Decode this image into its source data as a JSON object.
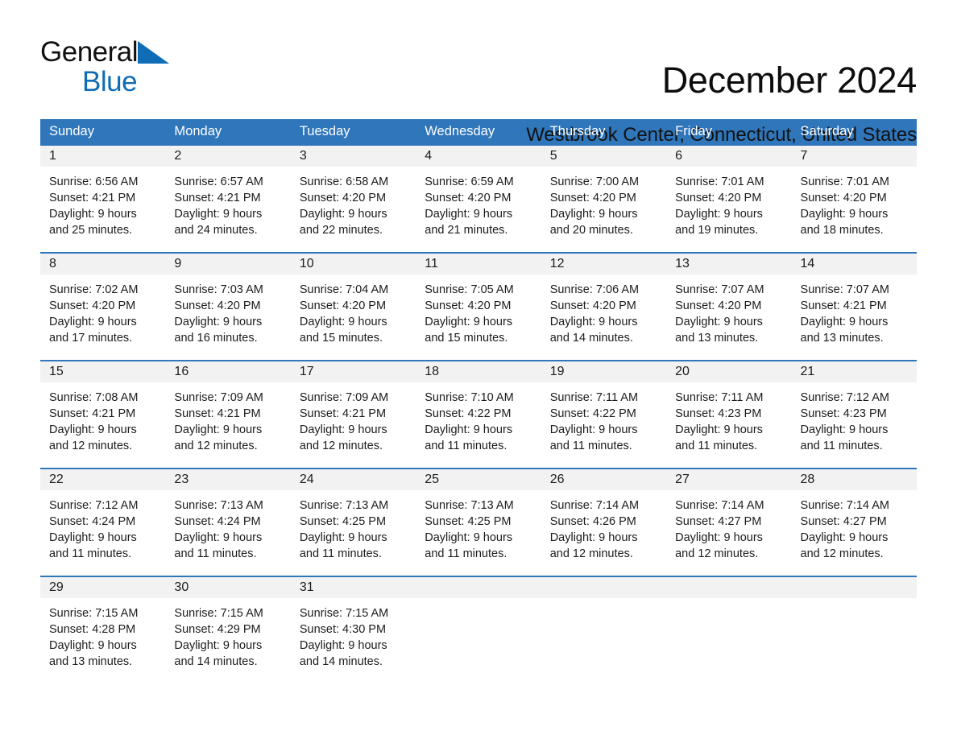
{
  "logo": {
    "word_general": "General",
    "word_blue": "Blue",
    "triangle_color": "#0f6cb6"
  },
  "header": {
    "month_title": "December 2024",
    "location": "Westbrook Center, Connecticut, United States"
  },
  "theme": {
    "header_blue": "#2f76bb",
    "daynum_band": "#f2f2f2",
    "text": "#1c1c1c"
  },
  "calendar": {
    "weekdays": [
      "Sunday",
      "Monday",
      "Tuesday",
      "Wednesday",
      "Thursday",
      "Friday",
      "Saturday"
    ],
    "weeks": [
      [
        {
          "day": "1",
          "sunrise": "Sunrise: 6:56 AM",
          "sunset": "Sunset: 4:21 PM",
          "daylight_line1": "Daylight: 9 hours",
          "daylight_line2": "and 25 minutes."
        },
        {
          "day": "2",
          "sunrise": "Sunrise: 6:57 AM",
          "sunset": "Sunset: 4:21 PM",
          "daylight_line1": "Daylight: 9 hours",
          "daylight_line2": "and 24 minutes."
        },
        {
          "day": "3",
          "sunrise": "Sunrise: 6:58 AM",
          "sunset": "Sunset: 4:20 PM",
          "daylight_line1": "Daylight: 9 hours",
          "daylight_line2": "and 22 minutes."
        },
        {
          "day": "4",
          "sunrise": "Sunrise: 6:59 AM",
          "sunset": "Sunset: 4:20 PM",
          "daylight_line1": "Daylight: 9 hours",
          "daylight_line2": "and 21 minutes."
        },
        {
          "day": "5",
          "sunrise": "Sunrise: 7:00 AM",
          "sunset": "Sunset: 4:20 PM",
          "daylight_line1": "Daylight: 9 hours",
          "daylight_line2": "and 20 minutes."
        },
        {
          "day": "6",
          "sunrise": "Sunrise: 7:01 AM",
          "sunset": "Sunset: 4:20 PM",
          "daylight_line1": "Daylight: 9 hours",
          "daylight_line2": "and 19 minutes."
        },
        {
          "day": "7",
          "sunrise": "Sunrise: 7:01 AM",
          "sunset": "Sunset: 4:20 PM",
          "daylight_line1": "Daylight: 9 hours",
          "daylight_line2": "and 18 minutes."
        }
      ],
      [
        {
          "day": "8",
          "sunrise": "Sunrise: 7:02 AM",
          "sunset": "Sunset: 4:20 PM",
          "daylight_line1": "Daylight: 9 hours",
          "daylight_line2": "and 17 minutes."
        },
        {
          "day": "9",
          "sunrise": "Sunrise: 7:03 AM",
          "sunset": "Sunset: 4:20 PM",
          "daylight_line1": "Daylight: 9 hours",
          "daylight_line2": "and 16 minutes."
        },
        {
          "day": "10",
          "sunrise": "Sunrise: 7:04 AM",
          "sunset": "Sunset: 4:20 PM",
          "daylight_line1": "Daylight: 9 hours",
          "daylight_line2": "and 15 minutes."
        },
        {
          "day": "11",
          "sunrise": "Sunrise: 7:05 AM",
          "sunset": "Sunset: 4:20 PM",
          "daylight_line1": "Daylight: 9 hours",
          "daylight_line2": "and 15 minutes."
        },
        {
          "day": "12",
          "sunrise": "Sunrise: 7:06 AM",
          "sunset": "Sunset: 4:20 PM",
          "daylight_line1": "Daylight: 9 hours",
          "daylight_line2": "and 14 minutes."
        },
        {
          "day": "13",
          "sunrise": "Sunrise: 7:07 AM",
          "sunset": "Sunset: 4:20 PM",
          "daylight_line1": "Daylight: 9 hours",
          "daylight_line2": "and 13 minutes."
        },
        {
          "day": "14",
          "sunrise": "Sunrise: 7:07 AM",
          "sunset": "Sunset: 4:21 PM",
          "daylight_line1": "Daylight: 9 hours",
          "daylight_line2": "and 13 minutes."
        }
      ],
      [
        {
          "day": "15",
          "sunrise": "Sunrise: 7:08 AM",
          "sunset": "Sunset: 4:21 PM",
          "daylight_line1": "Daylight: 9 hours",
          "daylight_line2": "and 12 minutes."
        },
        {
          "day": "16",
          "sunrise": "Sunrise: 7:09 AM",
          "sunset": "Sunset: 4:21 PM",
          "daylight_line1": "Daylight: 9 hours",
          "daylight_line2": "and 12 minutes."
        },
        {
          "day": "17",
          "sunrise": "Sunrise: 7:09 AM",
          "sunset": "Sunset: 4:21 PM",
          "daylight_line1": "Daylight: 9 hours",
          "daylight_line2": "and 12 minutes."
        },
        {
          "day": "18",
          "sunrise": "Sunrise: 7:10 AM",
          "sunset": "Sunset: 4:22 PM",
          "daylight_line1": "Daylight: 9 hours",
          "daylight_line2": "and 11 minutes."
        },
        {
          "day": "19",
          "sunrise": "Sunrise: 7:11 AM",
          "sunset": "Sunset: 4:22 PM",
          "daylight_line1": "Daylight: 9 hours",
          "daylight_line2": "and 11 minutes."
        },
        {
          "day": "20",
          "sunrise": "Sunrise: 7:11 AM",
          "sunset": "Sunset: 4:23 PM",
          "daylight_line1": "Daylight: 9 hours",
          "daylight_line2": "and 11 minutes."
        },
        {
          "day": "21",
          "sunrise": "Sunrise: 7:12 AM",
          "sunset": "Sunset: 4:23 PM",
          "daylight_line1": "Daylight: 9 hours",
          "daylight_line2": "and 11 minutes."
        }
      ],
      [
        {
          "day": "22",
          "sunrise": "Sunrise: 7:12 AM",
          "sunset": "Sunset: 4:24 PM",
          "daylight_line1": "Daylight: 9 hours",
          "daylight_line2": "and 11 minutes."
        },
        {
          "day": "23",
          "sunrise": "Sunrise: 7:13 AM",
          "sunset": "Sunset: 4:24 PM",
          "daylight_line1": "Daylight: 9 hours",
          "daylight_line2": "and 11 minutes."
        },
        {
          "day": "24",
          "sunrise": "Sunrise: 7:13 AM",
          "sunset": "Sunset: 4:25 PM",
          "daylight_line1": "Daylight: 9 hours",
          "daylight_line2": "and 11 minutes."
        },
        {
          "day": "25",
          "sunrise": "Sunrise: 7:13 AM",
          "sunset": "Sunset: 4:25 PM",
          "daylight_line1": "Daylight: 9 hours",
          "daylight_line2": "and 11 minutes."
        },
        {
          "day": "26",
          "sunrise": "Sunrise: 7:14 AM",
          "sunset": "Sunset: 4:26 PM",
          "daylight_line1": "Daylight: 9 hours",
          "daylight_line2": "and 12 minutes."
        },
        {
          "day": "27",
          "sunrise": "Sunrise: 7:14 AM",
          "sunset": "Sunset: 4:27 PM",
          "daylight_line1": "Daylight: 9 hours",
          "daylight_line2": "and 12 minutes."
        },
        {
          "day": "28",
          "sunrise": "Sunrise: 7:14 AM",
          "sunset": "Sunset: 4:27 PM",
          "daylight_line1": "Daylight: 9 hours",
          "daylight_line2": "and 12 minutes."
        }
      ],
      [
        {
          "day": "29",
          "sunrise": "Sunrise: 7:15 AM",
          "sunset": "Sunset: 4:28 PM",
          "daylight_line1": "Daylight: 9 hours",
          "daylight_line2": "and 13 minutes."
        },
        {
          "day": "30",
          "sunrise": "Sunrise: 7:15 AM",
          "sunset": "Sunset: 4:29 PM",
          "daylight_line1": "Daylight: 9 hours",
          "daylight_line2": "and 14 minutes."
        },
        {
          "day": "31",
          "sunrise": "Sunrise: 7:15 AM",
          "sunset": "Sunset: 4:30 PM",
          "daylight_line1": "Daylight: 9 hours",
          "daylight_line2": "and 14 minutes."
        },
        {
          "day": "",
          "sunrise": "",
          "sunset": "",
          "daylight_line1": "",
          "daylight_line2": ""
        },
        {
          "day": "",
          "sunrise": "",
          "sunset": "",
          "daylight_line1": "",
          "daylight_line2": ""
        },
        {
          "day": "",
          "sunrise": "",
          "sunset": "",
          "daylight_line1": "",
          "daylight_line2": ""
        },
        {
          "day": "",
          "sunrise": "",
          "sunset": "",
          "daylight_line1": "",
          "daylight_line2": ""
        }
      ]
    ]
  }
}
